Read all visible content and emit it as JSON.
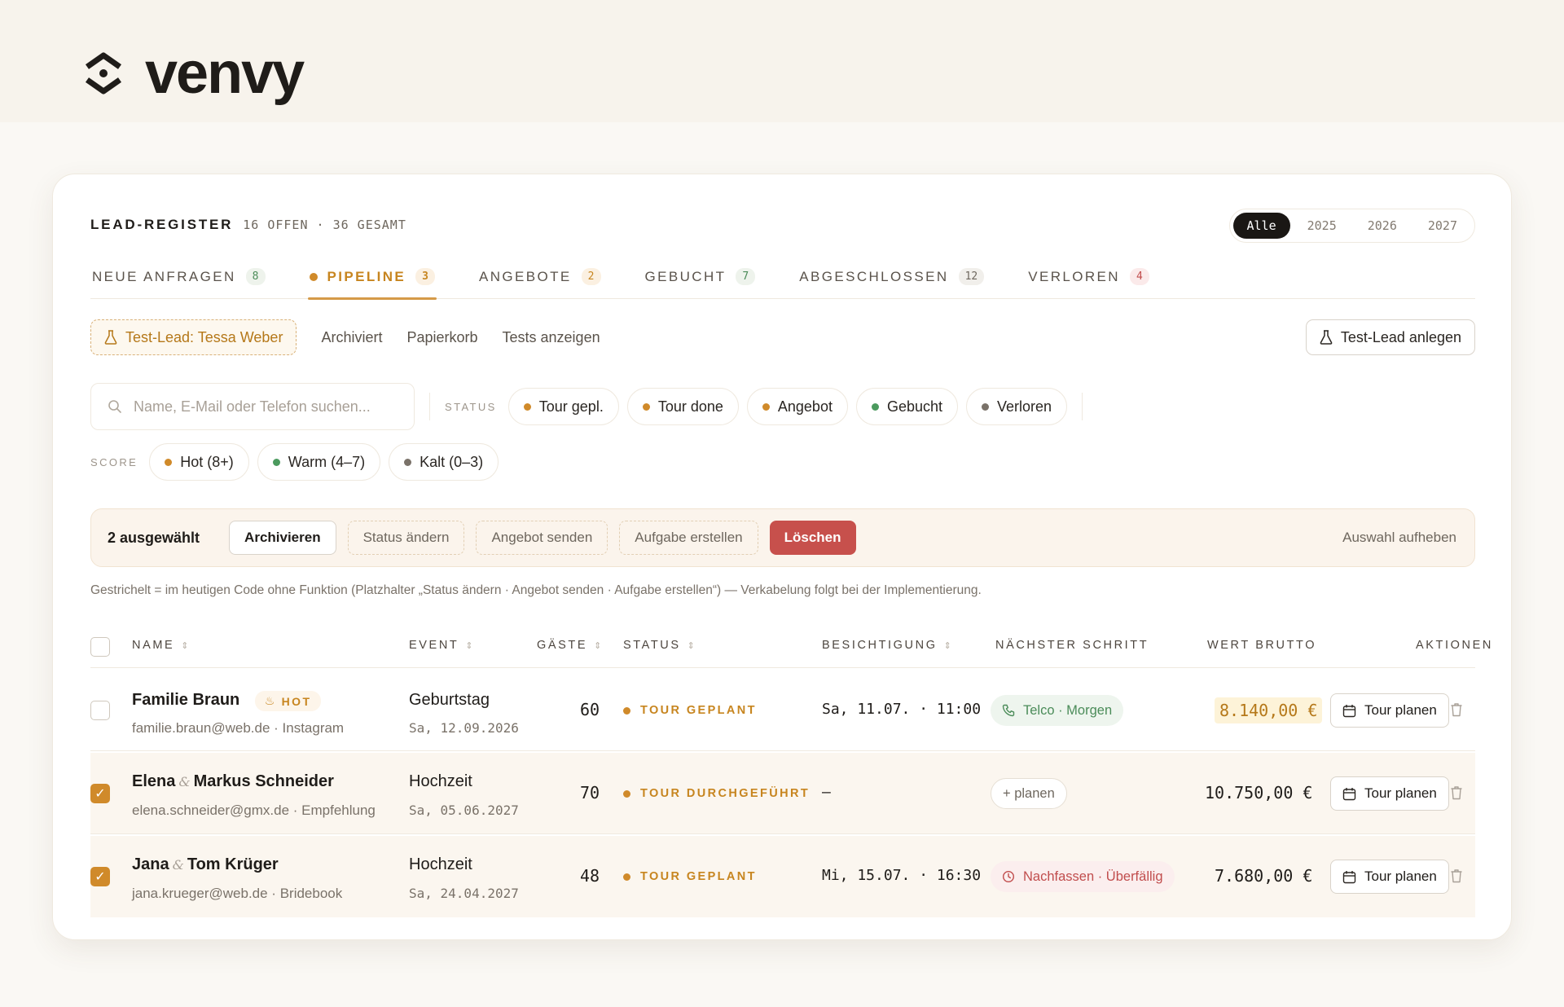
{
  "app": {
    "name": "venvy"
  },
  "register": {
    "title": "LEAD-REGISTER",
    "meta": "16 OFFEN · 36 GESAMT",
    "years": [
      "Alle",
      "2025",
      "2026",
      "2027"
    ],
    "active_year": "Alle"
  },
  "tabs": [
    {
      "label": "NEUE ANFRAGEN",
      "count": "8"
    },
    {
      "label": "PIPELINE",
      "count": "3",
      "active": true
    },
    {
      "label": "ANGEBOTE",
      "count": "2"
    },
    {
      "label": "GEBUCHT",
      "count": "7"
    },
    {
      "label": "ABGESCHLOSSEN",
      "count": "12"
    },
    {
      "label": "VERLOREN",
      "count": "4"
    }
  ],
  "filters": {
    "test_lead_chip": "Test-Lead: Tessa Weber",
    "links": [
      "Archiviert",
      "Papierkorb",
      "Tests anzeigen"
    ],
    "create_test_lead": "Test-Lead anlegen"
  },
  "search": {
    "placeholder": "Name, E-Mail oder Telefon suchen..."
  },
  "status_filter": {
    "label": "STATUS",
    "options": [
      {
        "label": "Tour gepl.",
        "color": "#d08a2a"
      },
      {
        "label": "Tour done",
        "color": "#d08a2a"
      },
      {
        "label": "Angebot",
        "color": "#d08a2a"
      },
      {
        "label": "Gebucht",
        "color": "#4b9a5e"
      },
      {
        "label": "Verloren",
        "color": "#7a7269"
      }
    ]
  },
  "score_filter": {
    "label": "SCORE",
    "options": [
      {
        "label": "Hot (8+)",
        "color": "#d08a2a"
      },
      {
        "label": "Warm (4–7)",
        "color": "#4b9a5e"
      },
      {
        "label": "Kalt (0–3)",
        "color": "#7a7269"
      }
    ]
  },
  "bulk": {
    "count": "2 ausgewählt",
    "archive": "Archivieren",
    "change_status": "Status ändern",
    "send_offer": "Angebot senden",
    "create_task": "Aufgabe erstellen",
    "delete": "Löschen",
    "clear": "Auswahl aufheben"
  },
  "note": "Gestrichelt = im heutigen Code ohne Funktion (Platzhalter „Status ändern · Angebot senden · Aufgabe erstellen“) — Verkabelung folgt bei der Implementierung.",
  "table": {
    "headers": {
      "name": "NAME",
      "event": "EVENT",
      "guests": "GÄSTE",
      "status": "STATUS",
      "viewing": "BESICHTIGUNG",
      "next_step": "NÄCHSTER SCHRITT",
      "value": "WERT BRUTTO",
      "actions": "AKTIONEN"
    },
    "rows": [
      {
        "name_a": "Familie Braun",
        "name_b": "",
        "badge": "HOT",
        "sub": "familie.braun@web.de · Instagram",
        "event": "Geburtstag",
        "event_date": "Sa, 12.09.2026",
        "guests": "60",
        "status": "TOUR GEPLANT",
        "viewing": "Sa, 11.07. · 11:00",
        "next_step": "Telco · Morgen",
        "next_kind": "green",
        "value": "8.140,00 €",
        "value_highlight": true,
        "action": "Tour planen",
        "selected": false
      },
      {
        "name_a": "Elena",
        "name_b": "Markus Schneider",
        "badge": "",
        "sub": "elena.schneider@gmx.de · Empfehlung",
        "event": "Hochzeit",
        "event_date": "Sa, 05.06.2027",
        "guests": "70",
        "status": "TOUR DURCHGEFÜHRT",
        "viewing": "—",
        "next_step": "+ planen",
        "next_kind": "plain",
        "value": "10.750,00 €",
        "value_highlight": false,
        "action": "Tour planen",
        "selected": true
      },
      {
        "name_a": "Jana",
        "name_b": "Tom Krüger",
        "badge": "",
        "sub": "jana.krueger@web.de · Bridebook",
        "event": "Hochzeit",
        "event_date": "Sa, 24.04.2027",
        "guests": "48",
        "status": "TOUR GEPLANT",
        "viewing": "Mi, 15.07. · 16:30",
        "next_step": "Nachfassen · Überfällig",
        "next_kind": "red",
        "value": "7.680,00 €",
        "value_highlight": false,
        "action": "Tour planen",
        "selected": true
      }
    ]
  }
}
